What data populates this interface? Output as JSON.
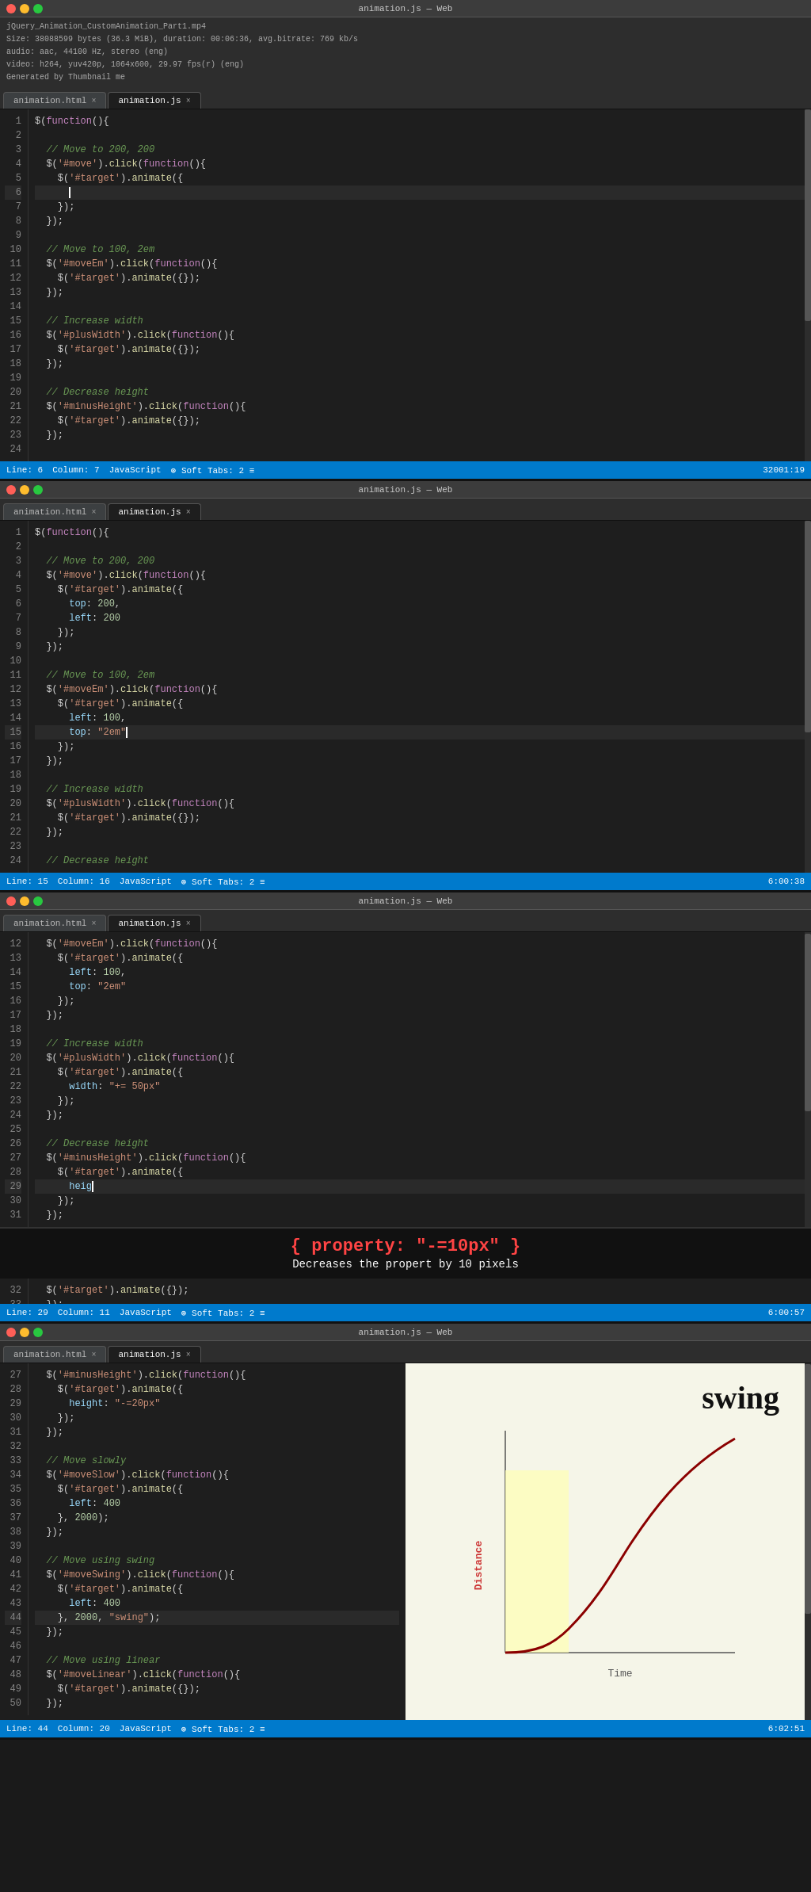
{
  "file_info": {
    "title": "jQuery_Animation_CustomAnimation_Part1.mp4",
    "size": "Size: 38088599 bytes (36.3 MiB), duration: 00:06:36, avg.bitrate: 769 kb/s",
    "audio": "audio: aac, 44100 Hz, stereo (eng)",
    "video": "video: h264, yuv420p, 1064x600, 29.97 fps(r) (eng)",
    "thumbnail": "Generated by Thumbnail me"
  },
  "panels": [
    {
      "id": "panel1",
      "title": "animation.js — Web",
      "tabs": [
        "animation.html",
        "animation.js"
      ],
      "active_tab": "animation.js",
      "status": {
        "line": "Line: 6",
        "column": "Column: 7",
        "language": "JavaScript",
        "soft_tabs": "Soft Tabs: 2",
        "encoding": "32001:19"
      },
      "lines": [
        {
          "n": 1,
          "code": "$(function(){"
        },
        {
          "n": 2,
          "code": ""
        },
        {
          "n": 3,
          "code": "  // Move to 200, 200",
          "class": "comment"
        },
        {
          "n": 4,
          "code": "  $('#move').click(function(){"
        },
        {
          "n": 5,
          "code": "    $('#target').animate({"
        },
        {
          "n": 6,
          "code": "      |",
          "current": true
        },
        {
          "n": 7,
          "code": "    });"
        },
        {
          "n": 8,
          "code": "  });"
        },
        {
          "n": 9,
          "code": ""
        },
        {
          "n": 10,
          "code": "  // Move to 100, 2em",
          "class": "comment"
        },
        {
          "n": 11,
          "code": "  $('#moveEm').click(function(){"
        },
        {
          "n": 12,
          "code": "    $('#target').animate({});"
        },
        {
          "n": 13,
          "code": "  });"
        },
        {
          "n": 14,
          "code": ""
        },
        {
          "n": 15,
          "code": "  // Increase width",
          "class": "comment"
        },
        {
          "n": 16,
          "code": "  $('#plusWidth').click(function(){"
        },
        {
          "n": 17,
          "code": "    $('#target').animate({});"
        },
        {
          "n": 18,
          "code": "  });"
        },
        {
          "n": 19,
          "code": ""
        },
        {
          "n": 20,
          "code": "  // Decrease height",
          "class": "comment"
        },
        {
          "n": 21,
          "code": "  $('#minusHeight').click(function(){"
        },
        {
          "n": 22,
          "code": "    $('#target').animate({});"
        },
        {
          "n": 23,
          "code": "  });"
        },
        {
          "n": 24,
          "code": ""
        }
      ]
    },
    {
      "id": "panel2",
      "title": "animation.js — Web",
      "tabs": [
        "animation.html",
        "animation.js"
      ],
      "active_tab": "animation.js",
      "status": {
        "line": "Line: 15",
        "column": "Column: 16",
        "language": "JavaScript",
        "soft_tabs": "Soft Tabs: 2",
        "encoding": "6:00:38"
      },
      "lines": [
        {
          "n": 1,
          "code": "$(function(){"
        },
        {
          "n": 2,
          "code": ""
        },
        {
          "n": 3,
          "code": "  // Move to 200, 200",
          "class": "comment"
        },
        {
          "n": 4,
          "code": "  $('#move').click(function(){"
        },
        {
          "n": 5,
          "code": "    $('#target').animate({"
        },
        {
          "n": 6,
          "code": "      top: 200,"
        },
        {
          "n": 7,
          "code": "      left: 200"
        },
        {
          "n": 8,
          "code": "    });"
        },
        {
          "n": 9,
          "code": "  });"
        },
        {
          "n": 10,
          "code": ""
        },
        {
          "n": 11,
          "code": "  // Move to 100, 2em",
          "class": "comment"
        },
        {
          "n": 12,
          "code": "  $('#moveEm').click(function(){"
        },
        {
          "n": 13,
          "code": "    $('#target').animate({"
        },
        {
          "n": 14,
          "code": "      left: 100,"
        },
        {
          "n": 15,
          "code": "      top: \"2em\"",
          "current": true
        },
        {
          "n": 16,
          "code": "    });"
        },
        {
          "n": 17,
          "code": "  });"
        },
        {
          "n": 18,
          "code": ""
        },
        {
          "n": 19,
          "code": "  // Increase width",
          "class": "comment"
        },
        {
          "n": 20,
          "code": "  $('#plusWidth').click(function(){"
        },
        {
          "n": 21,
          "code": "    $('#target').animate({});"
        },
        {
          "n": 22,
          "code": "  });"
        },
        {
          "n": 23,
          "code": ""
        },
        {
          "n": 24,
          "code": "  // Decrease height",
          "class": "comment"
        }
      ]
    },
    {
      "id": "panel3",
      "title": "animation.js — Web",
      "tabs": [
        "animation.html",
        "animation.js"
      ],
      "active_tab": "animation.js",
      "status": {
        "line": "Line: 29",
        "column": "Column: 11",
        "language": "JavaScript",
        "soft_tabs": "Soft Tabs: 2",
        "encoding": "6:00:57"
      },
      "lines": [
        {
          "n": 12,
          "code": "  $('#moveEm').click(function(){"
        },
        {
          "n": 13,
          "code": "    $('#target').animate({"
        },
        {
          "n": 14,
          "code": "      left: 100,"
        },
        {
          "n": 15,
          "code": "      top: \"2em\""
        },
        {
          "n": 16,
          "code": "    });"
        },
        {
          "n": 17,
          "code": "  });"
        },
        {
          "n": 18,
          "code": ""
        },
        {
          "n": 19,
          "code": "  // Increase width",
          "class": "comment"
        },
        {
          "n": 20,
          "code": "  $('#plusWidth').click(function(){"
        },
        {
          "n": 21,
          "code": "    $('#target').animate({"
        },
        {
          "n": 22,
          "code": "      width: \"+= 50px\""
        },
        {
          "n": 23,
          "code": "    });"
        },
        {
          "n": 24,
          "code": "  });"
        },
        {
          "n": 25,
          "code": ""
        },
        {
          "n": 26,
          "code": "  // Decrease height",
          "class": "comment"
        },
        {
          "n": 27,
          "code": "  $('#minusHeight').click(function(){"
        },
        {
          "n": 28,
          "code": "    $('#target').animate({"
        },
        {
          "n": 29,
          "code": "      heig|",
          "current": true
        },
        {
          "n": 30,
          "code": "    });"
        },
        {
          "n": 31,
          "code": "  });"
        }
      ],
      "tooltip": {
        "code": "{ property: \"-=10px\" }",
        "description": "Decreases the propert by 10 pixels"
      }
    },
    {
      "id": "panel4",
      "title": "animation.js — Web",
      "tabs": [
        "animation.html",
        "animation.js"
      ],
      "active_tab": "animation.js",
      "status": {
        "line": "Line: 44",
        "column": "Column: 20",
        "language": "JavaScript",
        "soft_tabs": "Soft Tabs: 2",
        "encoding": "6:02:51"
      },
      "lines": [
        {
          "n": 27,
          "code": "  $('#minusHeight').click(function(){"
        },
        {
          "n": 28,
          "code": "    $('#target').animate({"
        },
        {
          "n": 29,
          "code": "      height: \"-=20px\""
        },
        {
          "n": 30,
          "code": "    });"
        },
        {
          "n": 31,
          "code": "  });"
        },
        {
          "n": 32,
          "code": ""
        },
        {
          "n": 33,
          "code": "  // Move slowly",
          "class": "comment"
        },
        {
          "n": 34,
          "code": "  $('#moveSlow').click(function(){"
        },
        {
          "n": 35,
          "code": "    $('#target').animate({"
        },
        {
          "n": 36,
          "code": "      left: 400"
        },
        {
          "n": 37,
          "code": "    }, 2000);"
        },
        {
          "n": 38,
          "code": "  });"
        },
        {
          "n": 39,
          "code": ""
        },
        {
          "n": 40,
          "code": "  // Move using swing",
          "class": "comment"
        },
        {
          "n": 41,
          "code": "  $('#moveSwing').click(function(){"
        },
        {
          "n": 42,
          "code": "    $('#target').animate({"
        },
        {
          "n": 43,
          "code": "      left: 400"
        },
        {
          "n": 44,
          "code": "    }, 2000, \"swing\");",
          "current": true
        },
        {
          "n": 45,
          "code": "  });"
        },
        {
          "n": 46,
          "code": ""
        },
        {
          "n": 47,
          "code": "  // Move using linear",
          "class": "comment"
        },
        {
          "n": 48,
          "code": "  $('#moveLinear').click(function(){"
        },
        {
          "n": 49,
          "code": "    $('#target').animate({});"
        },
        {
          "n": 50,
          "code": "  });"
        }
      ],
      "chart": {
        "title": "swing",
        "x_label": "Time",
        "y_label": "Distance"
      }
    }
  ]
}
